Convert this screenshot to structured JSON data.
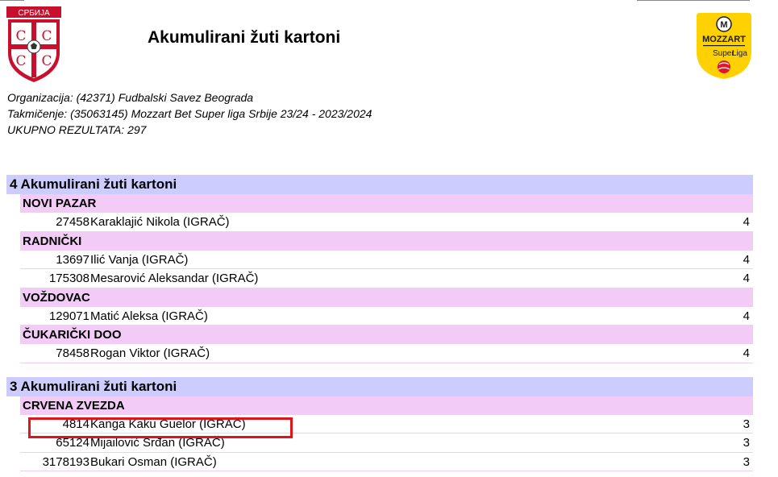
{
  "header": {
    "title": "Akumulirani žuti kartoni",
    "crest_text": "СРБИЈА",
    "sponsor_logo_text": [
      "MOZZART",
      "Super",
      "Liga"
    ]
  },
  "meta": {
    "organization": "Organizacija: (42371) Fudbalski Savez Beograda",
    "competition": "Takmičenje: (35063145) Mozzart Bet Super liga Srbije 23/24 - 2023/2024",
    "total": "UKUPNO REZULTATA: 297"
  },
  "colors": {
    "group_bg": "#ccccff",
    "club_bg": "#f2ccf7",
    "highlight": "#e0151b",
    "crest_red": "#c8102e",
    "logo_yellow": "#ffd100"
  },
  "groups": [
    {
      "label": "4 Akumulirani žuti kartoni",
      "clubs": [
        {
          "name": "NOVI PAZAR",
          "players": [
            {
              "id": "27458",
              "name": "Karaklajić Nikola (IGRAČ)",
              "value": "4"
            }
          ]
        },
        {
          "name": "RADNIČKI",
          "players": [
            {
              "id": "13697",
              "name": "Ilić Vanja (IGRAČ)",
              "value": "4"
            },
            {
              "id": "175308",
              "name": "Mesarović Aleksandar (IGRAČ)",
              "value": "4"
            }
          ]
        },
        {
          "name": "VOŽDOVAC",
          "players": [
            {
              "id": "129071",
              "name": "Matić Aleksa (IGRAČ)",
              "value": "4"
            }
          ]
        },
        {
          "name": "ČUKARIČKI DOO",
          "players": [
            {
              "id": "78458",
              "name": "Rogan Viktor (IGRAČ)",
              "value": "4"
            }
          ]
        }
      ]
    },
    {
      "label": "3 Akumulirani žuti kartoni",
      "clubs": [
        {
          "name": "CRVENA ZVEZDA",
          "players": [
            {
              "id": "4814",
              "name": "Kanga Kaku Guelor (IGRAČ)",
              "value": "3"
            },
            {
              "id": "65124",
              "name": "Mijailović Srđan (IGRAČ)",
              "value": "3"
            },
            {
              "id": "3178193",
              "name": "Bukari Osman (IGRAČ)",
              "value": "3"
            }
          ]
        }
      ]
    }
  ]
}
